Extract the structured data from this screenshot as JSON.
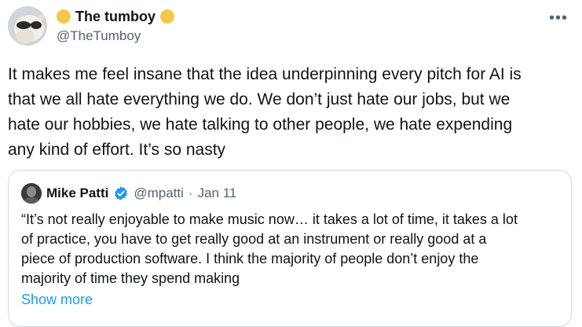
{
  "author": {
    "display_name": "The tumboy",
    "handle": "@TheTumboy",
    "badge_color": "#f4c84a"
  },
  "tweet": {
    "lines": [
      "It makes me feel insane that the idea underpinning every pitch for AI is",
      "that we all hate everything we do. We don’t just hate our jobs, but we",
      "hate our hobbies, we hate talking to other people, we hate expending",
      "any kind of effort. It’s so nasty"
    ]
  },
  "more_icon": "more-horizontal-icon",
  "quote": {
    "display_name": "Mike Patti",
    "handle": "@mpatti",
    "separator": "·",
    "date": "Jan 11",
    "verified_color": "#1d9bf0",
    "lines": [
      "“It’s not really enjoyable to make music now… it takes a lot of time, it takes a lot",
      "of practice, you have to get really good at an instrument or really good at a",
      "piece of production software. I think the majority of people don’t enjoy the",
      "majority of time they spend making"
    ],
    "show_more": "Show more"
  }
}
